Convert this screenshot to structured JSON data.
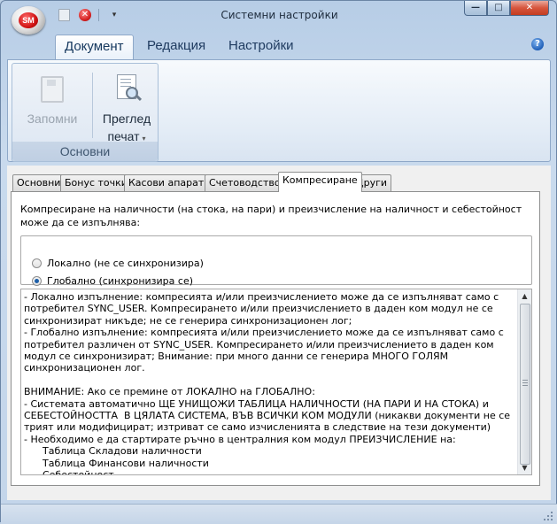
{
  "window": {
    "title": "Системни настройки",
    "app_logo": "SM"
  },
  "qat": {
    "save_icon": "floppy-disk-icon",
    "close_icon": "red-close-icon",
    "close_glyph": "✕",
    "customize_glyph": "▾"
  },
  "controls": {
    "minimize": "—",
    "maximize": "□",
    "close": "✕"
  },
  "ribbon": {
    "tabs": [
      "Документ",
      "Редакция",
      "Настройки"
    ],
    "active_tab": "Документ",
    "help_glyph": "?",
    "group_label": "Основни",
    "save_label": "Запомни",
    "print_label_1": "Преглед",
    "print_label_2": "печат",
    "print_caret": "▾"
  },
  "tabs": [
    "Основни",
    "Бонус точки",
    "Касови апарати",
    "Счетоводство",
    "Компресиране",
    "Други"
  ],
  "active_tab": "Компресиране",
  "panel": {
    "description": "Компресиране на наличности (на стока, на пари) и преизчисление на наличност и себестойност може да се изпълнява:",
    "options": [
      {
        "label": "Локално (не се синхронизира)",
        "checked": false
      },
      {
        "label": "Глобално (синхронизира се)",
        "checked": true
      }
    ],
    "notes": "- Локално изпълнение: компресията и/или преизчислението може да се изпълняват само с потребител SYNC_USER. Компресирането и/или преизчислението в даден ком модул не се синхронизират никъде; не се генерира синхронизационен лог;\n- Глобално изпълнение: компресията и/или преизчислението може да се изпълняват само с потребител различен от SYNC_USER. Компресирането и/или преизчислението в даден ком модул се синхронизират; Внимание: при много данни се генерира МНОГО ГОЛЯМ синхронизационен лог.\n\nВНИМАНИЕ: Ако се премине от ЛОКАЛНО на ГЛОБАЛНО:\n- Системата автоматично ЩЕ УНИЩОЖИ ТАБЛИЦА НАЛИЧНОСТИ (НА ПАРИ И НА СТОКА) и СЕБЕСТОЙНОСТТА  В ЦЯЛАТА СИСТЕМА, ВЪВ ВСИЧКИ КОМ МОДУЛИ (никакви документи не се трият или модифицират; изтриват се само изчисленията в следствие на тези документи)\n- Необходимо е да стартирате ръчно в централния ком модул ПРЕИЗЧИСЛЕНИЕ на:\n      Таблица Складови наличности\n      Таблица Финансови наличности\n      Себестойност"
  }
}
